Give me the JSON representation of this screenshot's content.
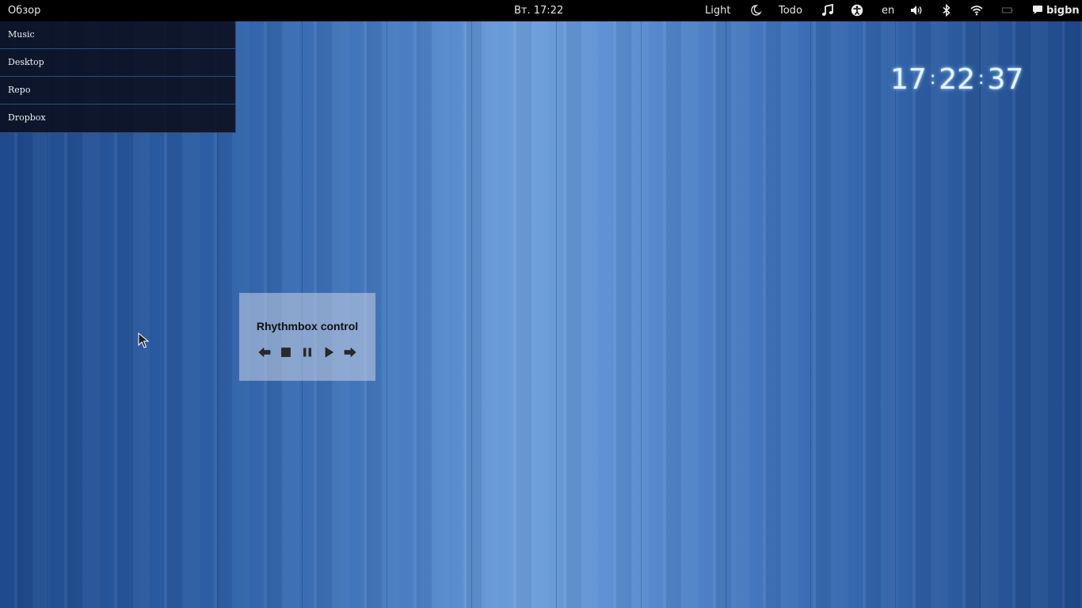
{
  "topbar": {
    "activities": "Обзор",
    "datetime": "Вт. 17:22",
    "light_label": "Light",
    "todo_label": "Todo",
    "keyboard_layout": "en",
    "user_name": "bigbn",
    "icons": [
      "night-mode-icon",
      "music-icon",
      "accessibility-icon",
      "volume-icon",
      "bluetooth-icon",
      "wifi-icon",
      "battery-icon",
      "chat-icon"
    ]
  },
  "places": {
    "items": [
      {
        "label": "Music"
      },
      {
        "label": "Desktop"
      },
      {
        "label": "Repo"
      },
      {
        "label": "Dropbox"
      }
    ]
  },
  "clock_widget": {
    "hours": "17",
    "minutes": "22",
    "seconds": "37",
    "separator": ":"
  },
  "rhythmbox": {
    "title": "Rhythmbox control",
    "buttons": [
      "previous-icon",
      "stop-icon",
      "pause-icon",
      "play-icon",
      "next-icon"
    ]
  },
  "colors": {
    "topbar_bg": "#000000",
    "desktop_accent": "#4a7fc4",
    "clock_glow": "#8cc8ff"
  }
}
